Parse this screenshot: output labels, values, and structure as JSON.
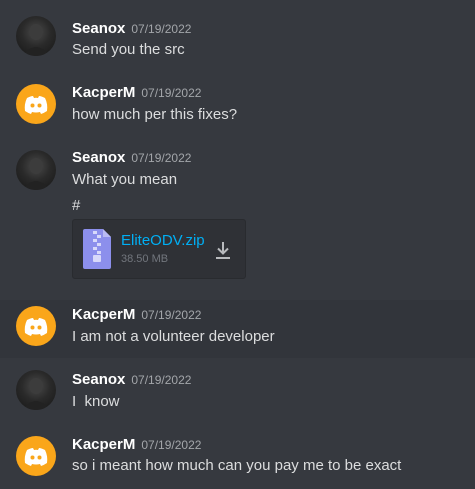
{
  "messages": [
    {
      "author": "Seanox",
      "time": "07/19/2022",
      "lines": [
        "Send you the src"
      ]
    },
    {
      "author": "KacperM",
      "time": "07/19/2022",
      "lines": [
        "how much per this fixes?"
      ]
    },
    {
      "author": "Seanox",
      "time": "07/19/2022",
      "lines": [
        "What you mean",
        "#"
      ]
    },
    {
      "author": "KacperM",
      "time": "07/19/2022",
      "lines": [
        "I am not a volunteer developer"
      ]
    },
    {
      "author": "Seanox",
      "time": "07/19/2022",
      "lines": [
        "I  know"
      ]
    },
    {
      "author": "KacperM",
      "time": "07/19/2022",
      "lines": [
        "so i meant how much can you pay me to be exact"
      ]
    }
  ],
  "attachment": {
    "filename": "EliteODV.zip",
    "size": "38.50 MB",
    "icon": "zip-file-icon",
    "action_icon": "download-icon"
  },
  "colors": {
    "background": "#36393f",
    "link": "#00aff4",
    "avatar_bot": "#faa61a"
  }
}
